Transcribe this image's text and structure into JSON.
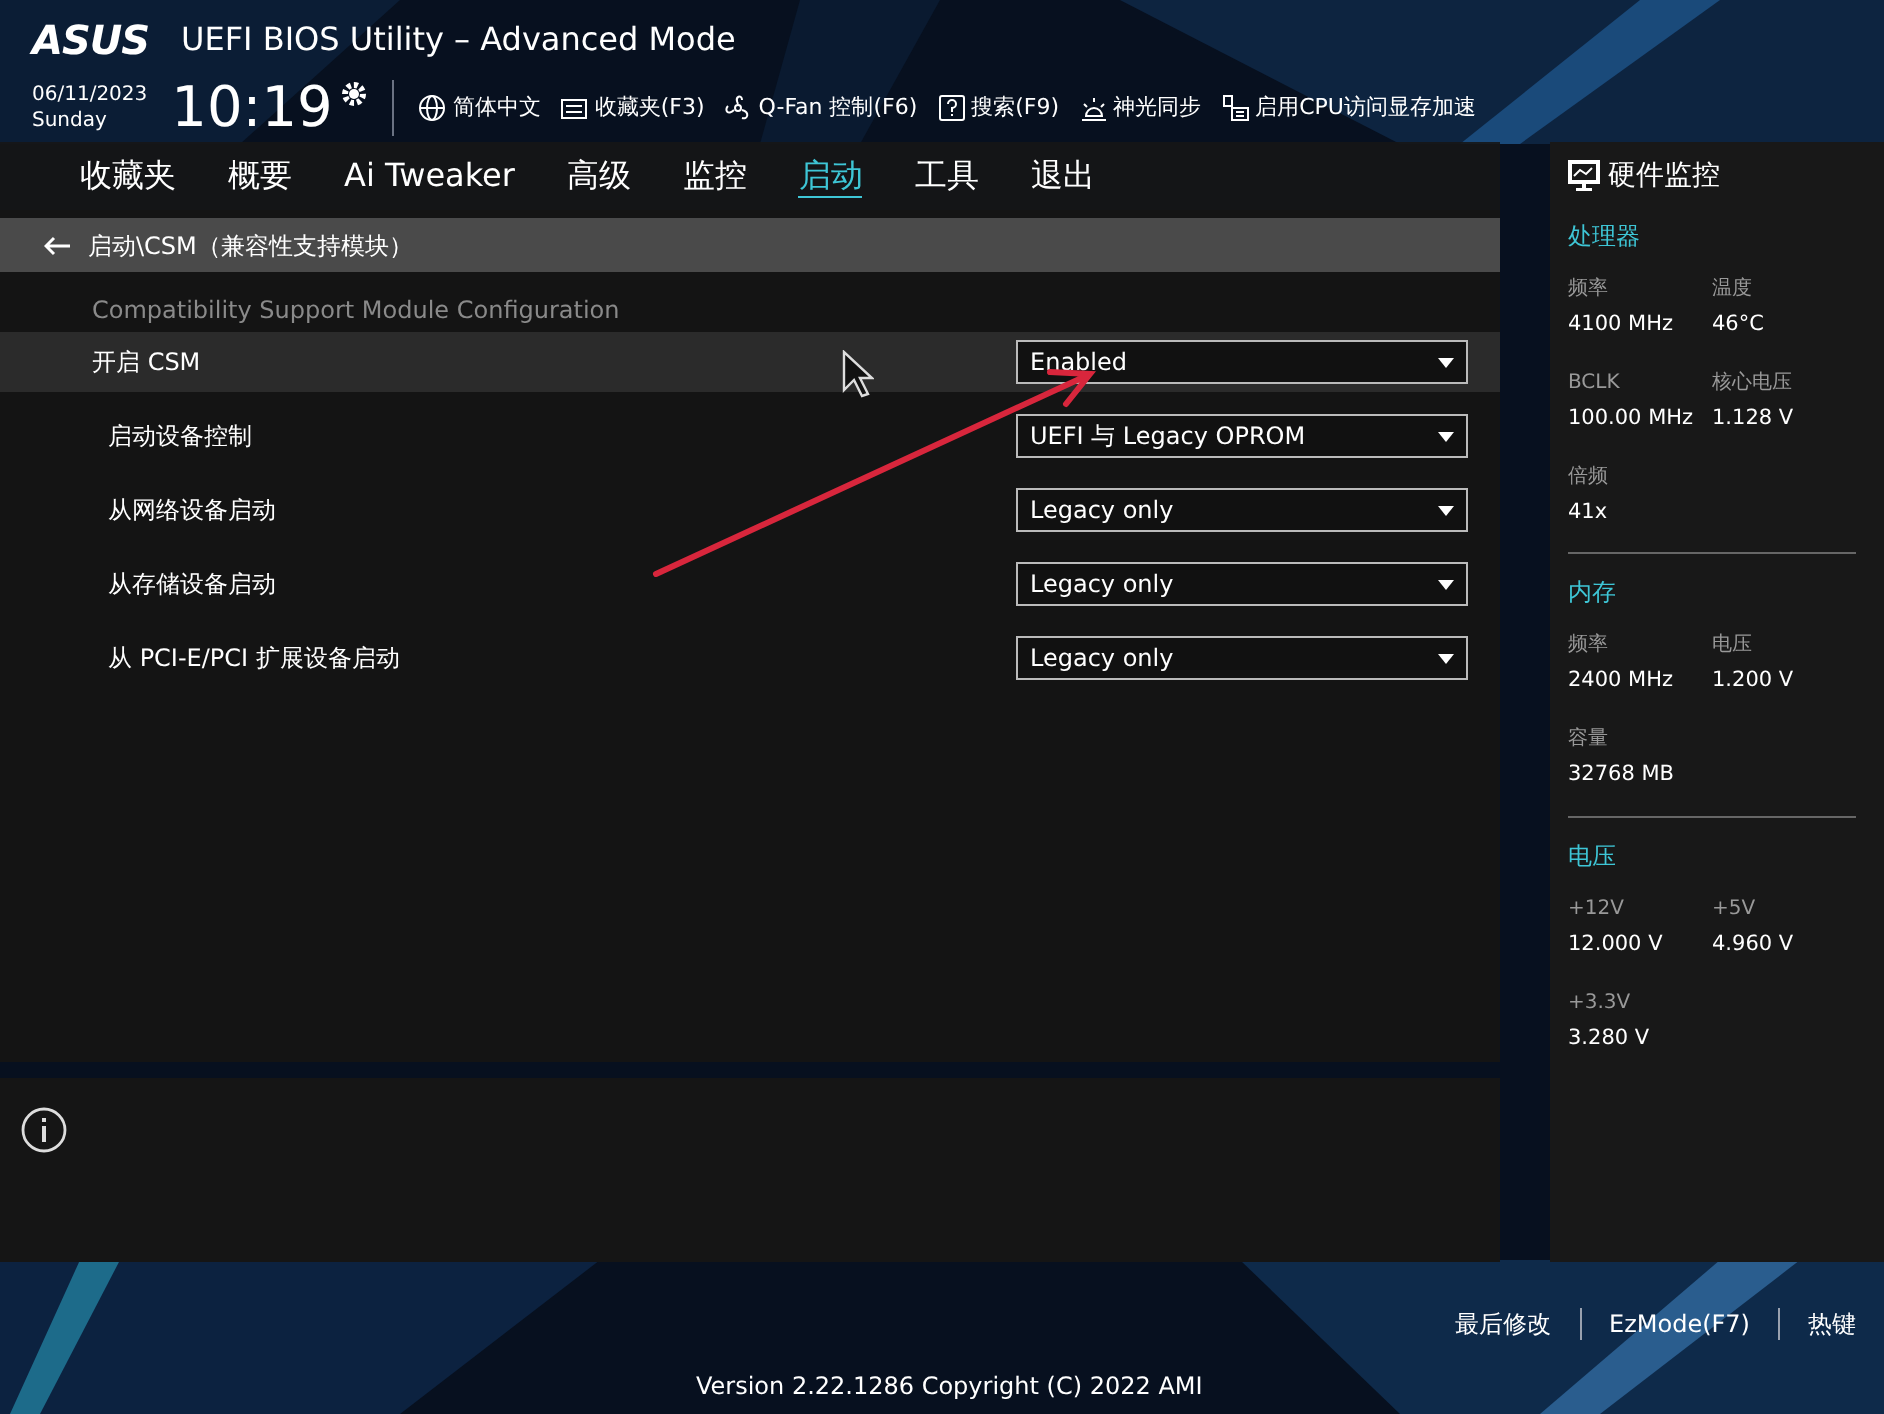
{
  "header": {
    "logo": "ASUS",
    "title": "UEFI BIOS Utility – Advanced Mode",
    "date": "06/11/2023",
    "day": "Sunday",
    "time": "10:19",
    "toolbar": [
      {
        "kind": "globe",
        "label": "简体中文"
      },
      {
        "kind": "folder",
        "label": "收藏夹(F3)"
      },
      {
        "kind": "fan",
        "label": "Q-Fan 控制(F6)"
      },
      {
        "kind": "help",
        "label": "搜索(F9)"
      },
      {
        "kind": "light",
        "label": "神光同步"
      },
      {
        "kind": "chip",
        "label": "启用CPU访问显存加速"
      }
    ]
  },
  "tabs": [
    {
      "label": "收藏夹",
      "selected": false
    },
    {
      "label": "概要",
      "selected": false
    },
    {
      "label": "Ai Tweaker",
      "selected": false
    },
    {
      "label": "高级",
      "selected": false
    },
    {
      "label": "监控",
      "selected": false
    },
    {
      "label": "启动",
      "selected": true
    },
    {
      "label": "工具",
      "selected": false
    },
    {
      "label": "退出",
      "selected": false
    }
  ],
  "breadcrumb": "启动\\CSM（兼容性支持模块）",
  "section_title": "Compatibility Support Module Configuration",
  "settings": [
    {
      "label": "开启 CSM",
      "value": "Enabled",
      "selected": true
    },
    {
      "label": "启动设备控制",
      "value": "UEFI 与 Legacy OPROM",
      "selected": false
    },
    {
      "label": "从网络设备启动",
      "value": "Legacy only",
      "selected": false
    },
    {
      "label": "从存储设备启动",
      "value": "Legacy only",
      "selected": false
    },
    {
      "label": "从 PCI-E/PCI 扩展设备启动",
      "value": "Legacy only",
      "selected": false
    }
  ],
  "monitor": {
    "title": "硬件监控",
    "sections": [
      {
        "title": "处理器",
        "items": [
          {
            "label": "频率",
            "value": "4100 MHz"
          },
          {
            "label": "温度",
            "value": "46°C"
          },
          {
            "label": "BCLK",
            "value": "100.00 MHz"
          },
          {
            "label": "核心电压",
            "value": "1.128 V"
          },
          {
            "label": "倍频",
            "value": "41x"
          }
        ]
      },
      {
        "title": "内存",
        "items": [
          {
            "label": "频率",
            "value": "2400 MHz"
          },
          {
            "label": "电压",
            "value": "1.200 V"
          },
          {
            "label": "容量",
            "value": "32768 MB"
          }
        ]
      },
      {
        "title": "电压",
        "items": [
          {
            "label": "+12V",
            "value": "12.000 V"
          },
          {
            "label": "+5V",
            "value": "4.960 V"
          },
          {
            "label": "+3.3V",
            "value": "3.280 V"
          }
        ]
      }
    ]
  },
  "footer": {
    "version": "Version 2.22.1286 Copyright (C) 2022 AMI",
    "buttons": [
      "最后修改",
      "EzMode(F7)",
      "热键"
    ]
  }
}
